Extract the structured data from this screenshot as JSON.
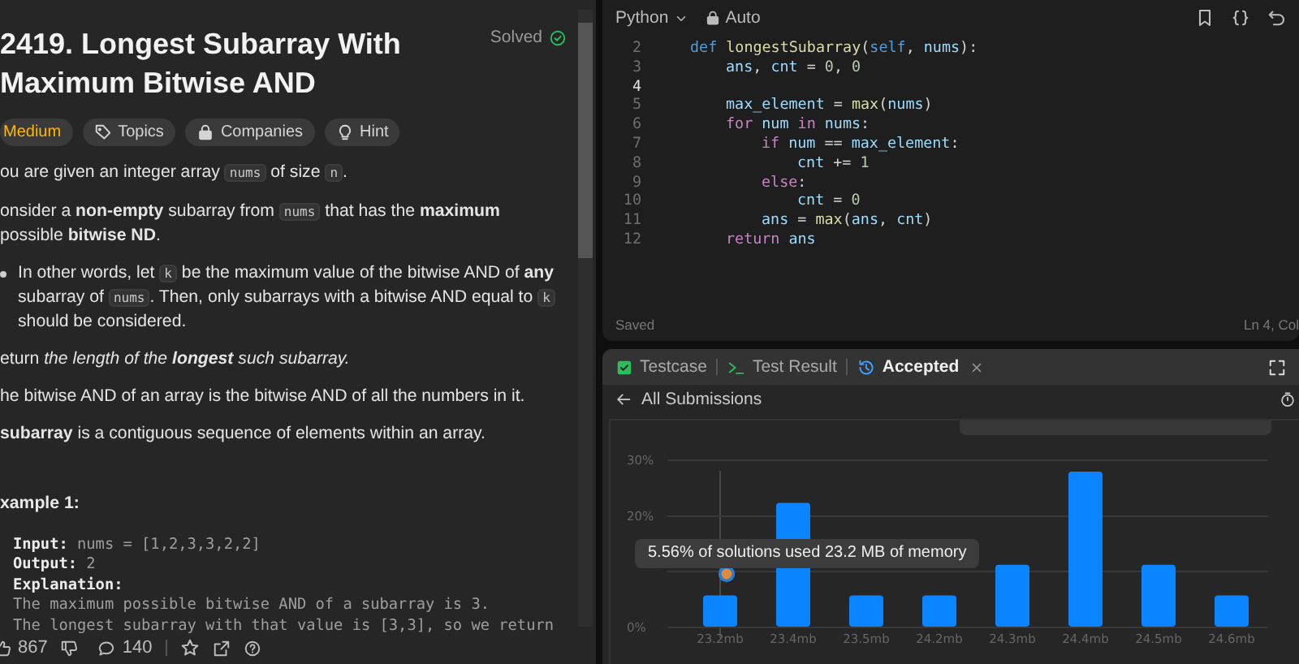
{
  "problem": {
    "title": "2419. Longest Subarray With Maximum Bitwise AND",
    "status": "Solved",
    "tags": [
      {
        "kind": "difficulty",
        "label": "Medium"
      },
      {
        "kind": "topics",
        "label": "Topics"
      },
      {
        "kind": "companies",
        "label": "Companies"
      },
      {
        "kind": "hint",
        "label": "Hint"
      }
    ],
    "paragraphs": [
      {
        "kind": "para",
        "segments": [
          {
            "kind": "text",
            "text": "ou are given an integer array "
          },
          {
            "kind": "code",
            "text": "nums"
          },
          {
            "kind": "text",
            "text": " of size "
          },
          {
            "kind": "code",
            "text": "n"
          },
          {
            "kind": "text",
            "text": "."
          }
        ]
      },
      {
        "kind": "para",
        "segments": [
          {
            "kind": "text",
            "text": "onsider a **non-empty** subarray from "
          },
          {
            "kind": "code",
            "text": "nums"
          },
          {
            "kind": "text",
            "text": " that has the **maximum** possible **bitwise ND**."
          }
        ]
      },
      {
        "kind": "bullet",
        "segments": [
          {
            "kind": "text",
            "text": "In other words, let "
          },
          {
            "kind": "code",
            "text": "k"
          },
          {
            "kind": "text",
            "text": " be the maximum value of the bitwise AND of **any** subarray of "
          },
          {
            "kind": "code",
            "text": "nums"
          },
          {
            "kind": "text",
            "text": ". Then, only subarrays with a bitwise AND equal to "
          },
          {
            "kind": "code",
            "text": "k"
          },
          {
            "kind": "text",
            "text": " should be considered."
          }
        ]
      },
      {
        "kind": "para",
        "segments": [
          {
            "kind": "text",
            "text": "eturn *the length of the* "
          },
          {
            "kind": "strong-italic",
            "text": "longest"
          },
          {
            "kind": "text",
            "text": " *such subarray.*"
          }
        ]
      },
      {
        "kind": "para",
        "segments": [
          {
            "kind": "text",
            "text": "he bitwise AND of an array is the bitwise AND of all the numbers in it."
          }
        ]
      },
      {
        "kind": "para",
        "segments": [
          {
            "kind": "text",
            "text": "**subarray** is a contiguous sequence of elements within an array."
          }
        ]
      }
    ],
    "example": {
      "heading": "xample 1:",
      "lines": [
        {
          "kind": "field",
          "label": "Input:",
          "value": "nums = [1,2,3,3,2,2]"
        },
        {
          "kind": "field",
          "label": "Output:",
          "value": "2"
        },
        {
          "kind": "field",
          "label": "Explanation:"
        },
        {
          "kind": "plain",
          "value": "The maximum possible bitwise AND of a subarray is 3."
        },
        {
          "kind": "plain",
          "value": "The longest subarray with that value is [3,3], so we return"
        }
      ]
    },
    "likes": "867",
    "comments": "140"
  },
  "editor": {
    "language": "Python",
    "mode": "Auto",
    "lines": [
      {
        "number": "2",
        "active": false,
        "tokens": [
          {
            "kind": "keyword",
            "text": "def"
          },
          {
            "kind": "function",
            "text": " longestSubarray"
          },
          {
            "kind": "plain",
            "text": "("
          },
          {
            "kind": "keyword",
            "text": "self"
          },
          {
            "kind": "plain",
            "text": ", "
          },
          {
            "kind": "variable",
            "text": "nums"
          },
          {
            "kind": "plain",
            "text": "):"
          }
        ],
        "children": [
          {
            "number": "3",
            "active": false,
            "tokens": [
              {
                "kind": "variable",
                "text": "ans"
              },
              {
                "kind": "plain",
                "text": ", "
              },
              {
                "kind": "variable",
                "text": "cnt"
              },
              {
                "kind": "plain",
                "text": " = "
              },
              {
                "kind": "number",
                "text": "0"
              },
              {
                "kind": "plain",
                "text": ", "
              },
              {
                "kind": "number",
                "text": "0"
              }
            ]
          },
          {
            "number": "4",
            "active": true
          },
          {
            "number": "5",
            "active": false,
            "tokens": [
              {
                "kind": "variable",
                "text": "max_element"
              },
              {
                "kind": "plain",
                "text": " = "
              },
              {
                "kind": "function",
                "text": "max"
              },
              {
                "kind": "plain",
                "text": "("
              },
              {
                "kind": "variable",
                "text": "nums"
              },
              {
                "kind": "plain",
                "text": ")"
              }
            ]
          },
          {
            "number": "6",
            "active": false,
            "tokens": [
              {
                "kind": "control",
                "text": "for"
              },
              {
                "kind": "variable",
                "text": " num"
              },
              {
                "kind": "control",
                "text": " in"
              },
              {
                "kind": "variable",
                "text": " nums"
              },
              {
                "kind": "plain",
                "text": ":"
              }
            ],
            "children": [
              {
                "number": "7",
                "active": false,
                "tokens": [
                  {
                    "kind": "control",
                    "text": "if"
                  },
                  {
                    "kind": "variable",
                    "text": " num"
                  },
                  {
                    "kind": "plain",
                    "text": " == "
                  },
                  {
                    "kind": "variable",
                    "text": "max_element"
                  },
                  {
                    "kind": "plain",
                    "text": ":"
                  }
                ],
                "children": [
                  {
                    "number": "8",
                    "active": false,
                    "tokens": [
                      {
                        "kind": "variable",
                        "text": "cnt"
                      },
                      {
                        "kind": "plain",
                        "text": " += "
                      },
                      {
                        "kind": "number",
                        "text": "1"
                      }
                    ]
                  }
                ]
              },
              {
                "number": "9",
                "active": false,
                "tokens": [
                  {
                    "kind": "control",
                    "text": "else"
                  },
                  {
                    "kind": "plain",
                    "text": ":"
                  }
                ],
                "children": [
                  {
                    "number": "10",
                    "active": false,
                    "tokens": [
                      {
                        "kind": "variable",
                        "text": "cnt"
                      },
                      {
                        "kind": "plain",
                        "text": " = "
                      },
                      {
                        "kind": "number",
                        "text": "0"
                      }
                    ]
                  }
                ]
              },
              {
                "number": "11",
                "active": false,
                "tokens": [
                  {
                    "kind": "variable",
                    "text": "ans"
                  },
                  {
                    "kind": "plain",
                    "text": " = "
                  },
                  {
                    "kind": "function",
                    "text": "max"
                  },
                  {
                    "kind": "plain",
                    "text": "("
                  },
                  {
                    "kind": "variable",
                    "text": "ans"
                  },
                  {
                    "kind": "plain",
                    "text": ", "
                  },
                  {
                    "kind": "variable",
                    "text": "cnt"
                  },
                  {
                    "kind": "plain",
                    "text": ")"
                  }
                ]
              }
            ]
          },
          {
            "number": "12",
            "active": false,
            "tokens": [
              {
                "kind": "control",
                "text": "return"
              },
              {
                "kind": "variable",
                "text": " ans"
              }
            ]
          }
        ]
      }
    ],
    "status": "Saved",
    "cursor": "Ln 4, Col"
  },
  "result": {
    "tabs": [
      {
        "kind": "testcase",
        "label": "Testcase",
        "selected": false
      },
      {
        "kind": "result",
        "label": "Test Result",
        "selected": false
      },
      {
        "kind": "accepted",
        "label": "Accepted",
        "selected": true
      }
    ],
    "back_label": "All Submissions",
    "tooltip": "5.56% of solutions used 23.2 MB of memory",
    "chart_data": {
      "type": "bar",
      "categories": [
        "23.2mb",
        "23.4mb",
        "23.5mb",
        "24.2mb",
        "24.3mb",
        "24.4mb",
        "24.5mb",
        "24.6mb"
      ],
      "series": [
        {
          "color": "#0a84ff",
          "values": [
            5.6,
            22.2,
            5.6,
            5.6,
            11.1,
            27.8,
            11.1,
            5.6
          ]
        }
      ],
      "ylim": [
        0,
        30
      ],
      "yticks": [
        {
          "value": 0,
          "label": "0%"
        },
        {
          "value": 20,
          "label": "20%"
        },
        {
          "value": 30,
          "label": "30%"
        }
      ]
    }
  }
}
